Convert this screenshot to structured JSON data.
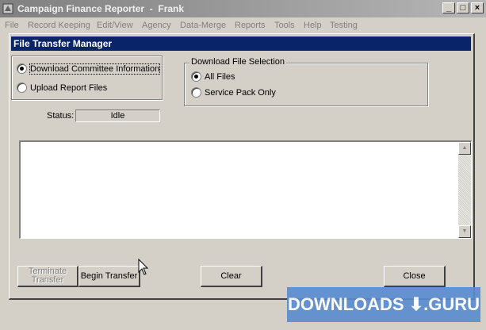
{
  "app": {
    "title": "Campaign Finance Reporter  -  Frank",
    "window_buttons": [
      "_",
      "□",
      "×"
    ]
  },
  "menu": [
    {
      "label": "File"
    },
    {
      "label": "Record Keeping"
    },
    {
      "label": "Edit/View"
    },
    {
      "label": "Agency"
    },
    {
      "label": "Data-Merge"
    },
    {
      "label": "Reports"
    },
    {
      "label": "Tools"
    },
    {
      "label": "Help"
    },
    {
      "label": "Testing"
    }
  ],
  "dialog": {
    "title": "File Transfer Manager",
    "mode": {
      "options": [
        {
          "label": "Download Committee Information",
          "selected": true
        },
        {
          "label": "Upload Report Files",
          "selected": false
        }
      ]
    },
    "download_selection": {
      "legend": "Download File Selection",
      "options": [
        {
          "label": "All Files",
          "selected": true
        },
        {
          "label": "Service Pack Only",
          "selected": false
        }
      ]
    },
    "status": {
      "label": "Status:",
      "value": "Idle"
    },
    "log_text": "",
    "buttons": {
      "terminate": "Terminate Transfer",
      "terminate_line1": "Terminate",
      "terminate_line2": "Transfer",
      "begin": "Begin Transfer",
      "clear": "Clear",
      "close": "Close"
    }
  },
  "watermark": {
    "text": "DOWNLOADS ⬇.GURU"
  }
}
